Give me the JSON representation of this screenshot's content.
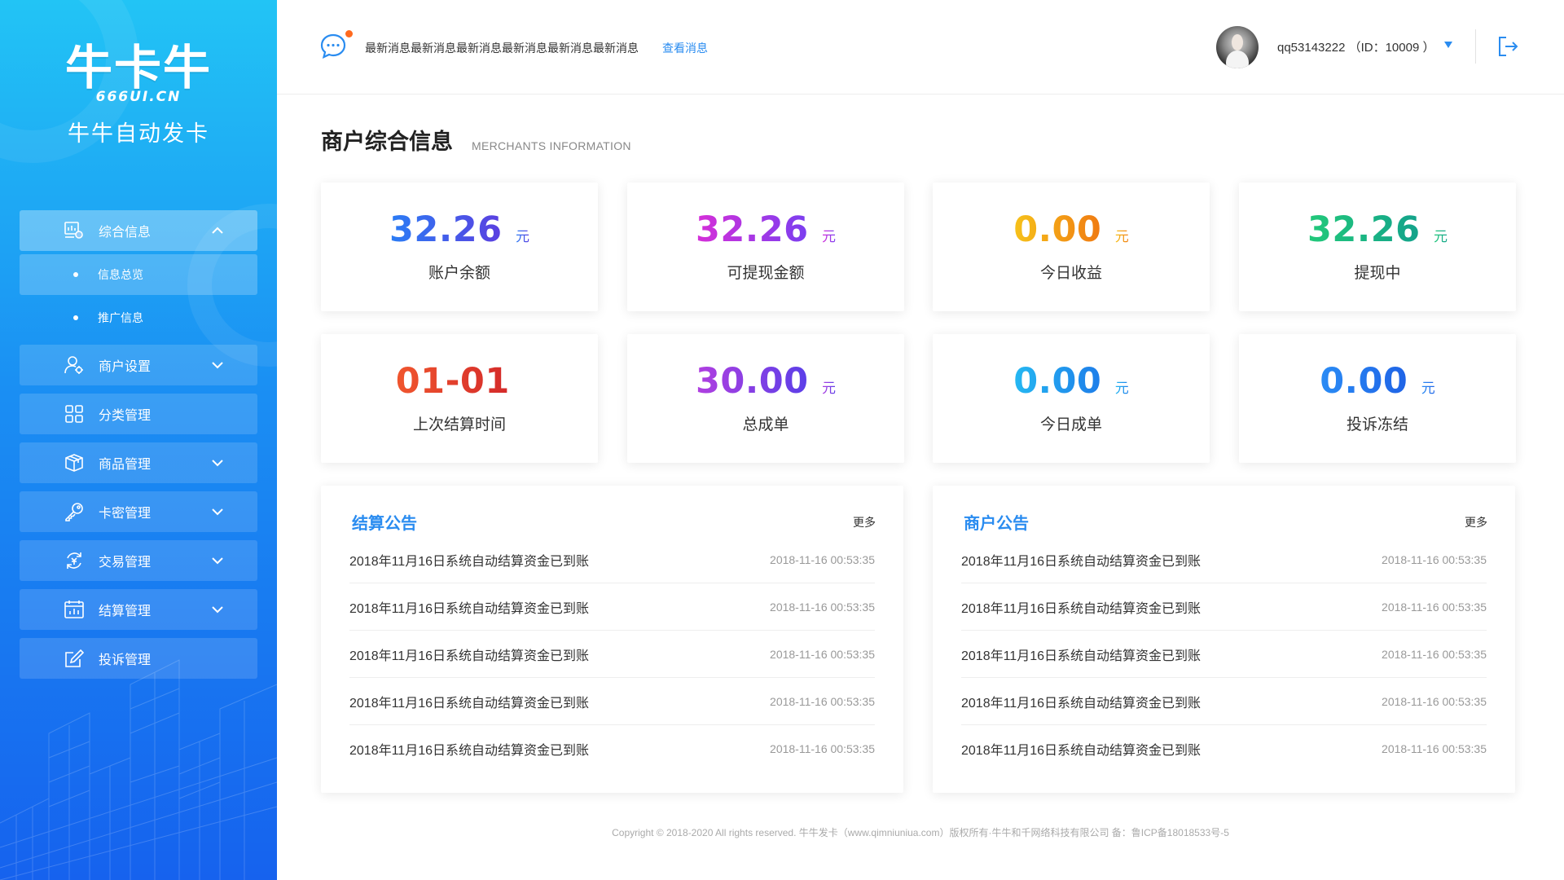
{
  "brand": {
    "logo_mark": "牛卡牛",
    "logo_sub": "666UI.CN",
    "name": "牛牛自动发卡"
  },
  "sidebar": {
    "items": [
      {
        "label": "综合信息",
        "icon": "dashboard-icon",
        "active": true,
        "expanded": true,
        "children": [
          {
            "label": "信息总览",
            "active": true
          },
          {
            "label": "推广信息",
            "active": false
          }
        ]
      },
      {
        "label": "商户设置",
        "icon": "user-gear-icon",
        "expandable": true
      },
      {
        "label": "分类管理",
        "icon": "grid-icon",
        "expandable": false
      },
      {
        "label": "商品管理",
        "icon": "box-icon",
        "expandable": true
      },
      {
        "label": "卡密管理",
        "icon": "key-icon",
        "expandable": true
      },
      {
        "label": "交易管理",
        "icon": "exchange-icon",
        "expandable": true
      },
      {
        "label": "结算管理",
        "icon": "calendar-chart-icon",
        "expandable": true
      },
      {
        "label": "投诉管理",
        "icon": "edit-icon",
        "expandable": false
      }
    ]
  },
  "header": {
    "message": "最新消息最新消息最新消息最新消息最新消息最新消息",
    "message_link": "查看消息",
    "user": "qq53143222 （ID：10009 ）",
    "icons": [
      "message-icon",
      "chevron-down-icon",
      "logout-icon"
    ],
    "notification_color": "#ff6a1f"
  },
  "page": {
    "title": "商户综合信息",
    "subtitle": "MERCHANTS INFORMATION"
  },
  "stats": [
    {
      "value": "32.26",
      "unit": "元",
      "label": "账户余额",
      "gradient": [
        "#2a7df5",
        "#5b3fe0"
      ]
    },
    {
      "value": "32.26",
      "unit": "元",
      "label": "可提现金额",
      "gradient": [
        "#d62fd8",
        "#7a3ff0"
      ]
    },
    {
      "value": "0.00",
      "unit": "元",
      "label": "今日收益",
      "gradient": [
        "#f6c21a",
        "#f07a12"
      ]
    },
    {
      "value": "32.26",
      "unit": "元",
      "label": "提现中",
      "gradient": [
        "#22c97a",
        "#13a28b"
      ]
    },
    {
      "value": "01-01",
      "unit": "",
      "label": "上次结算时间",
      "gradient": [
        "#f0562e",
        "#d42a2a"
      ]
    },
    {
      "value": "30.00",
      "unit": "元",
      "label": "总成单",
      "gradient": [
        "#b13fe0",
        "#5a3fe8"
      ]
    },
    {
      "value": "0.00",
      "unit": "元",
      "label": "今日成单",
      "gradient": [
        "#25b8f2",
        "#1e7de9"
      ]
    },
    {
      "value": "0.00",
      "unit": "元",
      "label": "投诉冻结",
      "gradient": [
        "#2a8cf5",
        "#1f63e6"
      ]
    }
  ],
  "notices": {
    "settlement": {
      "title": "结算公告",
      "more": "更多",
      "rows": [
        {
          "text": "2018年11月16日系统自动结算资金已到账",
          "time": "2018-11-16  00:53:35"
        },
        {
          "text": "2018年11月16日系统自动结算资金已到账",
          "time": "2018-11-16  00:53:35"
        },
        {
          "text": "2018年11月16日系统自动结算资金已到账",
          "time": "2018-11-16  00:53:35"
        },
        {
          "text": "2018年11月16日系统自动结算资金已到账",
          "time": "2018-11-16  00:53:35"
        },
        {
          "text": "2018年11月16日系统自动结算资金已到账",
          "time": "2018-11-16  00:53:35"
        }
      ]
    },
    "merchant": {
      "title": "商户公告",
      "more": "更多",
      "rows": [
        {
          "text": "2018年11月16日系统自动结算资金已到账",
          "time": "2018-11-16  00:53:35"
        },
        {
          "text": "2018年11月16日系统自动结算资金已到账",
          "time": "2018-11-16  00:53:35"
        },
        {
          "text": "2018年11月16日系统自动结算资金已到账",
          "time": "2018-11-16  00:53:35"
        },
        {
          "text": "2018年11月16日系统自动结算资金已到账",
          "time": "2018-11-16  00:53:35"
        },
        {
          "text": "2018年11月16日系统自动结算资金已到账",
          "time": "2018-11-16  00:53:35"
        }
      ]
    }
  },
  "footer": "Copyright © 2018-2020 All rights reserved. 牛牛发卡（www.qimniuniua.com）版权所有·牛牛和千网络科技有限公司 备：鲁ICP备18018533号-5",
  "colors": {
    "accent": "#2a8cf0",
    "sidebar_top": "#22c4f5",
    "sidebar_bottom": "#1662ee"
  }
}
